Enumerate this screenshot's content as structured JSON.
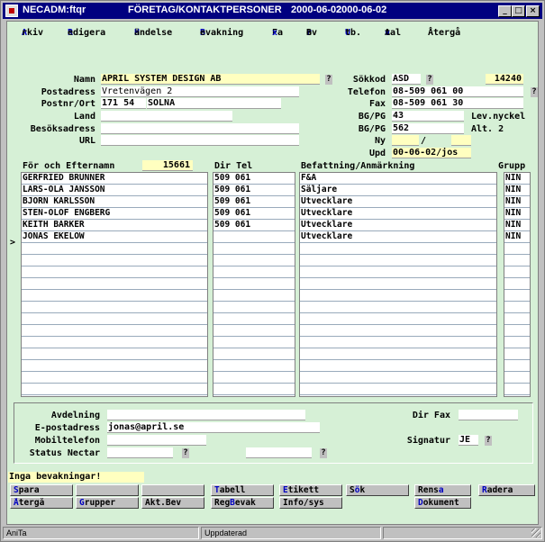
{
  "window": {
    "app": "NECADM:ftqr",
    "title": "FÖRETAG/KONTAKTPERSONER",
    "date1": "2000-06-02",
    "date2": "2000-06-02",
    "min_glyph": "_",
    "max_glyph": "□",
    "close_glyph": "×"
  },
  "menu": [
    {
      "hot": "A",
      "rest": "rkiv"
    },
    {
      "hot": "R",
      "rest": "edigera"
    },
    {
      "hot": "H",
      "rest": "ändelse"
    },
    {
      "hot": "B",
      "rest": "evakning"
    },
    {
      "pre": "Fa",
      "hot": "x",
      "rest": ""
    },
    {
      "pre": "B",
      "hot": "r",
      "rest": "ev"
    },
    {
      "hot": "U",
      "rest": "tb."
    },
    {
      "pre": "A",
      "hot": "v",
      "rest": "tal"
    },
    {
      "pre": "",
      "hot": "",
      "rest": "Återgå"
    }
  ],
  "company": {
    "name_label": "Namn",
    "name": "APRIL SYSTEM DESIGN AB",
    "postadress_label": "Postadress",
    "postadress": "Vretenvägen 2",
    "postnr_label": "Postnr/Ort",
    "postnr": "171 54",
    "ort": "SOLNA",
    "land_label": "Land",
    "land": "",
    "besok_label": "Besöksadress",
    "besok": "",
    "url_label": "URL",
    "url": "",
    "sokkod_label": "Sökkod",
    "sokkod": "ASD",
    "id": "14240",
    "telefon_label": "Telefon",
    "telefon": "08-509 061 00",
    "fax_label": "Fax",
    "fax": "08-509 061 30",
    "bgpg_label": "BG/PG",
    "bgpg1": "43",
    "levnyckel_label": "Lev.nyckel",
    "bgpg2_label": "BG/PG",
    "bgpg2": "562",
    "alt_label": "Alt. 2",
    "ny_label": "Ny",
    "ny": "",
    "ny_sep": "/",
    "upd_label": "Upd",
    "upd": "00-06-02/jos",
    "qmark": "?"
  },
  "contacts": {
    "name_header": "För och Efternamn",
    "count": "15661",
    "dirtel_header": "Dir Tel",
    "befattning_header": "Befattning/Anmärkning",
    "grupp_header": "Grupp",
    "current_marker": ">",
    "rows": [
      {
        "name": "GERFRIED BRUNNER",
        "tel": "509 061",
        "title": "F&A",
        "group": "NIN"
      },
      {
        "name": "LARS-OLA JANSSON",
        "tel": "509 061",
        "title": "Säljare",
        "group": "NIN"
      },
      {
        "name": "BJÖRN KARLSSON",
        "tel": "509 061",
        "title": "Utvecklare",
        "group": "NIN"
      },
      {
        "name": "STEN-OLOF ENGBERG",
        "tel": "509 061",
        "title": "Utvecklare",
        "group": "NIN"
      },
      {
        "name": "KEITH BARKER",
        "tel": "509 061",
        "title": "Utvecklare",
        "group": "NIN"
      },
      {
        "name": "JONAS EKELÖW",
        "tel": "",
        "title": "Utvecklare",
        "group": "NIN"
      }
    ]
  },
  "detail": {
    "avdelning_label": "Avdelning",
    "avdelning": "",
    "epost_label": "E-postadress",
    "epost": "jonas@april.se",
    "mobil_label": "Mobiltelefon",
    "mobil": "",
    "status_label": "Status Nectar",
    "status1": "",
    "status2": "",
    "dirfax_label": "Dir Fax",
    "dirfax": "",
    "signatur_label": "Signatur",
    "signatur": "JE"
  },
  "message": "Inga bevakningar!",
  "buttons": {
    "spara": {
      "hot": "S",
      "rest": "para"
    },
    "atergå": {
      "hot": "Å",
      "rest": "tergå"
    },
    "grupper": {
      "hot": "G",
      "rest": "rupper"
    },
    "aktbev": {
      "hot": "",
      "rest": "Akt.Bev"
    },
    "tabell": {
      "hot": "T",
      "rest": "abell"
    },
    "regbevak": {
      "hot": "",
      "pre": "Reg",
      "mid": "B",
      "post": "evak"
    },
    "etikett": {
      "hot": "E",
      "rest": "tikett"
    },
    "infosys": {
      "hot": "",
      "rest": "Info/sys"
    },
    "sok": {
      "pre": "S",
      "hot": "ö",
      "rest": "k"
    },
    "rensa": {
      "pre": "Rens",
      "hot": "a",
      "rest": ""
    },
    "dokument": {
      "hot": "D",
      "rest": "okument"
    },
    "radera": {
      "hot": "R",
      "rest": "adera"
    }
  },
  "statusbar": {
    "left": "AniTa",
    "middle": "Uppdaterad",
    "right": ""
  }
}
